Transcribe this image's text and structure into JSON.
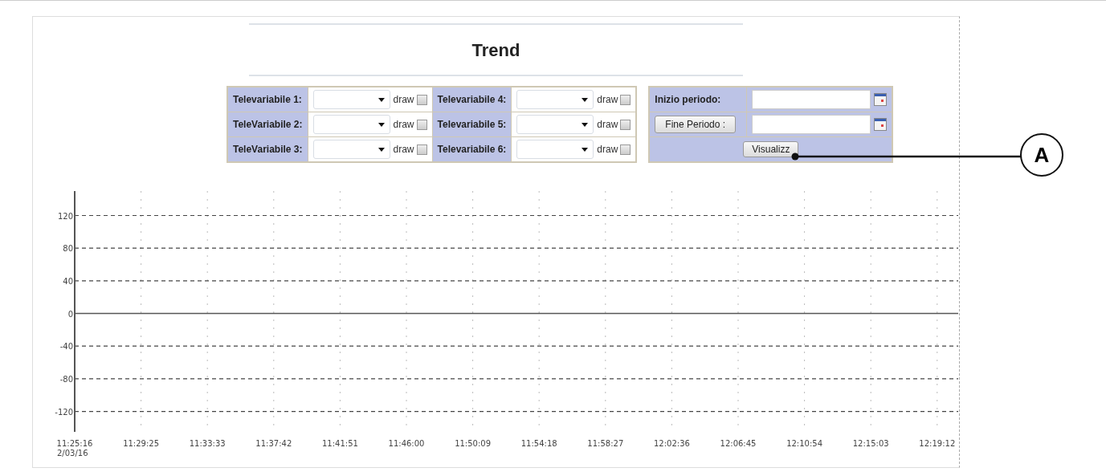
{
  "title": "Trend",
  "variables": [
    {
      "label": "Televariabile 1:",
      "draw_label": "draw",
      "checked": false
    },
    {
      "label": "TeleVariabile 2:",
      "draw_label": "draw",
      "checked": false
    },
    {
      "label": "TeleVariabile 3:",
      "draw_label": "draw",
      "checked": false
    },
    {
      "label": "Televariabile 4:",
      "draw_label": "draw",
      "checked": false
    },
    {
      "label": "Televariabile 5:",
      "draw_label": "draw",
      "checked": false
    },
    {
      "label": "Televariabile 6:",
      "draw_label": "draw",
      "checked": false
    }
  ],
  "period": {
    "start_label": "Inizio periodo:",
    "end_button": "Fine Periodo :",
    "submit_button": "Visualizz"
  },
  "chart": {
    "x_date_label": "2/03/16",
    "chart_data": {
      "type": "line",
      "categories": [
        "11:25:16",
        "11:29:25",
        "11:33:33",
        "11:37:42",
        "11:41:51",
        "11:46:00",
        "11:50:09",
        "11:54:18",
        "11:58:27",
        "12:02:36",
        "12:06:45",
        "12:10:54",
        "12:15:03",
        "12:19:12"
      ],
      "ylim": [
        -145,
        150
      ],
      "grid": true,
      "yticks": [
        120,
        80,
        40,
        0,
        -40,
        -80,
        -120
      ]
    }
  },
  "callouts": [
    {
      "label": "A"
    }
  ]
}
